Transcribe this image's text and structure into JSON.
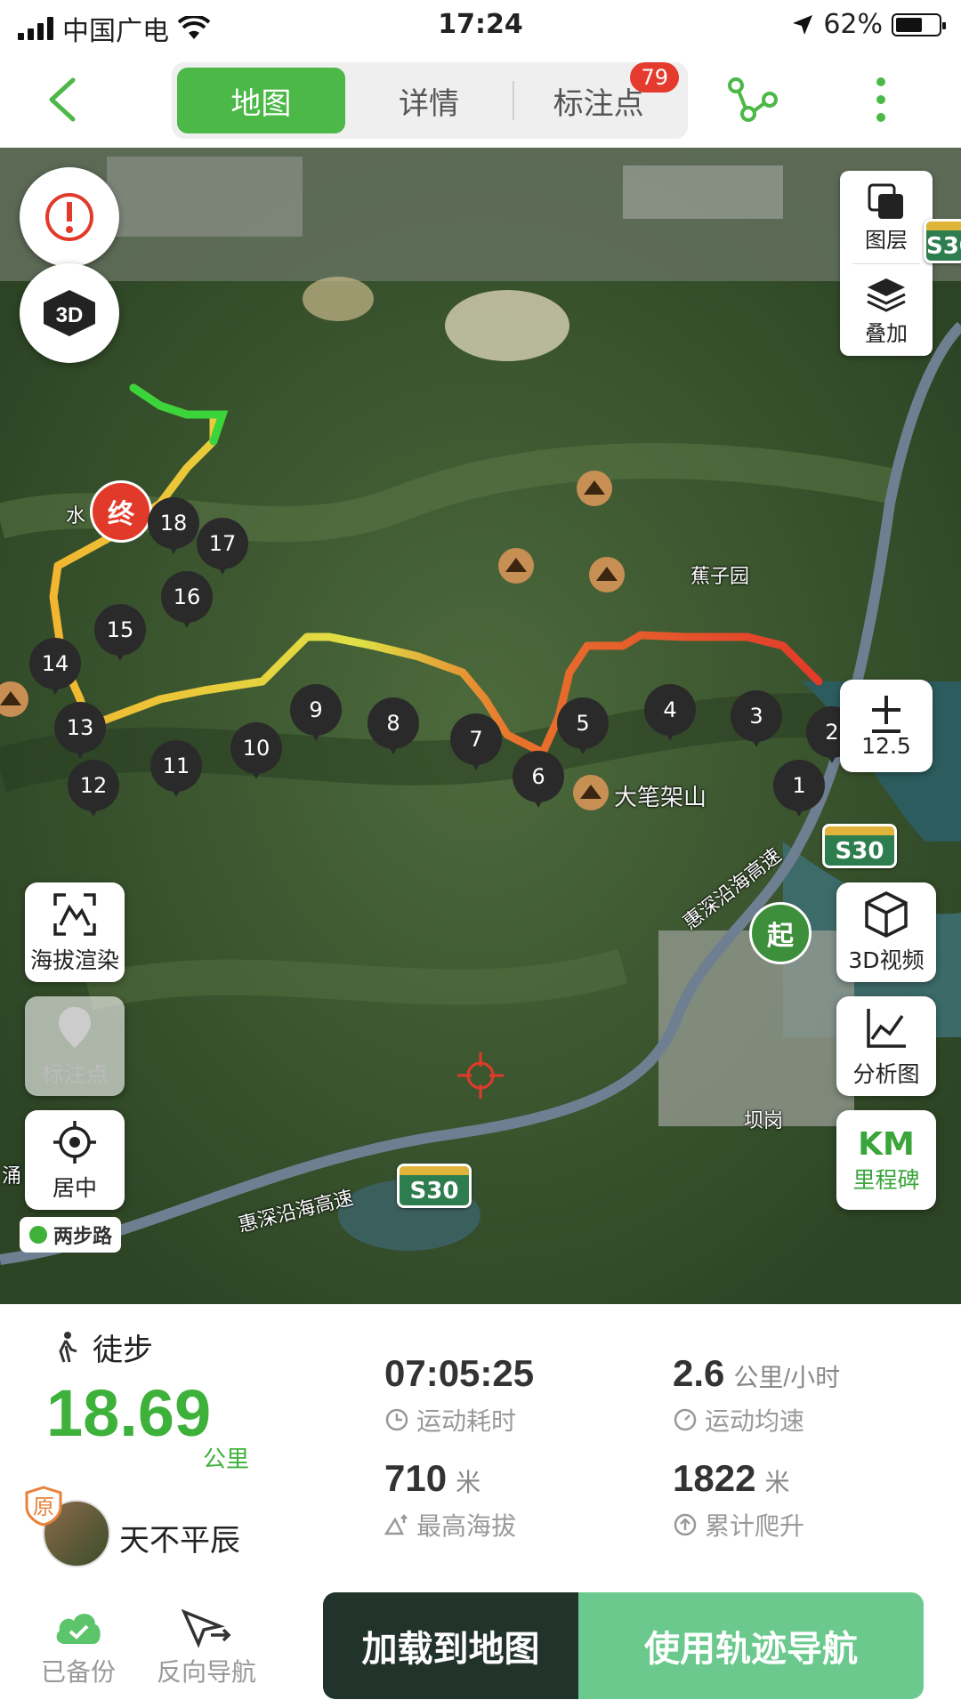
{
  "status_bar": {
    "carrier": "中国广电",
    "time": "17:24",
    "battery": "62%",
    "battery_level": 0.62
  },
  "top_nav": {
    "tabs": [
      {
        "label": "地图",
        "active": true
      },
      {
        "label": "详情",
        "active": false
      },
      {
        "label": "标注点",
        "active": false,
        "badge": "79"
      }
    ]
  },
  "map": {
    "layer_label": "图层",
    "overlay_label": "叠加",
    "zoom_level": "12.5",
    "altitude_render_label": "海拔渲染",
    "marker_label": "标注点",
    "center_label": "居中",
    "view3d_label": "3D视频",
    "analysis_label": "分析图",
    "milestone_km": "KM",
    "milestone_label": "里程碑",
    "start_label": "起",
    "end_label": "终",
    "brand": "两步路",
    "place_labels": {
      "peak": "大笔架山",
      "village": "蕉子园",
      "town": "坝岗",
      "highway": "惠深沿海高速",
      "highway2": "惠深沿海高速",
      "water": "水",
      "edge": "涌"
    },
    "road_shield": "S30",
    "waypoints": [
      "1",
      "2",
      "3",
      "4",
      "5",
      "6",
      "7",
      "8",
      "9",
      "10",
      "11",
      "12",
      "13",
      "14",
      "15",
      "16",
      "17",
      "18"
    ]
  },
  "stats": {
    "activity": "徒步",
    "distance": "18.69",
    "distance_unit": "公里",
    "username": "天不平辰",
    "original_badge": "原",
    "duration": "07:05:25",
    "duration_label": "运动耗时",
    "avg_speed": "2.6",
    "avg_speed_unit": "公里/小时",
    "avg_speed_label": "运动均速",
    "max_altitude": "710",
    "max_altitude_unit": "米",
    "max_altitude_label": "最高海拔",
    "total_climb": "1822",
    "total_climb_unit": "米",
    "total_climb_label": "累计爬升"
  },
  "bottom": {
    "backup_label": "已备份",
    "reverse_label": "反向导航",
    "load_label": "加载到地图",
    "navigate_label": "使用轨迹导航"
  },
  "colors": {
    "accent": "#4cb847",
    "badge": "#e43b2e",
    "dark_button": "#22332b",
    "green_button": "#6bc98d"
  }
}
